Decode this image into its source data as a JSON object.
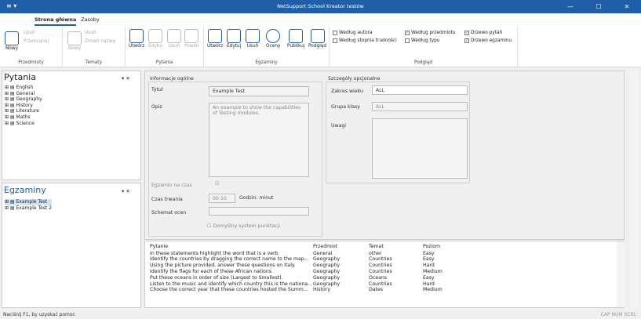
{
  "window": {
    "title": "NetSupport School Kreator testów",
    "qa_icon": "≡ ▾",
    "min": "—",
    "max": "☐",
    "close": "✕"
  },
  "tabs": [
    {
      "label": "Strona główna"
    },
    {
      "label": "Zasoby"
    }
  ],
  "ribbon": {
    "przedmioty": {
      "label": "Przedmioty",
      "nowy": "Nowy",
      "usun": "Usuń",
      "przemianuj": "Przemianuj"
    },
    "tematy": {
      "label": "Tematy",
      "nowy": "Nowy",
      "usun": "Usuń",
      "zmien": "Zmień nazwę"
    },
    "pytania": {
      "label": "Pytania",
      "utworz": "Utwórz",
      "edytuj": "Edytuj",
      "usun": "Usuń",
      "powiel": "Powiel"
    },
    "egzaminy": {
      "label": "Egzaminy",
      "utworz": "Utwórz",
      "edytuj": "Edytuj",
      "usun": "Usuń",
      "oceny": "Oceny",
      "publikuj": "Publikuj",
      "podglad": "Podgląd"
    },
    "podglad": {
      "label": "Podgląd",
      "autor": "Według autora",
      "stopien": "Według stopnia trudności",
      "przedmiot": "Według przedmiotu",
      "typ": "Według typu",
      "drzewo_pytan": "Drzewo pytań",
      "drzewo_egz": "Drzewo egzaminu"
    }
  },
  "pytania_panel": {
    "title": "Pytania",
    "close": "▾  ✕",
    "items": [
      "English",
      "General",
      "Geography",
      "History",
      "Literature",
      "Maths",
      "Science"
    ]
  },
  "egzaminy_panel": {
    "title": "Egzaminy",
    "close": "▾  ✕",
    "items": [
      "Example Test",
      "Example Test 2"
    ]
  },
  "form": {
    "general": "Informacje ogólne",
    "tytul_lbl": "Tytuł",
    "tytul": "Example Test",
    "opis_lbl": "Opis",
    "opis": "An example to show the capabilities of Testing modules.",
    "czas_lbl": "Egzamin na czas",
    "trwanie_lbl": "Czas trwania",
    "trwanie": "00:10",
    "godzin": "Godzin: minut",
    "schemat_lbl": "Schemat ocen",
    "domyslny": "Domyślny system punktacji",
    "opc": "Szczegóły opcjonalne",
    "zakres_lbl": "Zakres wieku",
    "zakres": "ALL",
    "grupa_lbl": "Grupa klasy",
    "grupa": "ALL",
    "uwagi_lbl": "Uwagi"
  },
  "grid": {
    "headers": [
      "Pytanie",
      "Przedmiot",
      "Temat",
      "Poziom"
    ],
    "rows": [
      [
        "In these statements highlight the word that is a verb",
        "General",
        "other",
        "Easy"
      ],
      [
        "Identify the countries by dragging the correct name to the map...",
        "Geography",
        "Countries",
        "Easy"
      ],
      [
        "Using the picture provided, answer these questions on Italy.",
        "Geography",
        "Countries",
        "Hard"
      ],
      [
        "Identify the flags for each of these African nations.",
        "Geography",
        "Countries",
        "Medium"
      ],
      [
        "Put these oceans in order of size (Largest to Smallest).",
        "Geography",
        "Oceans",
        "Easy"
      ],
      [
        "Listen to the music and identify which country this is the nationa...",
        "Geography",
        "Countries",
        "Hard"
      ],
      [
        "Choose the correct year that these countries hosted the Summ...",
        "History",
        "Dates",
        "Medium"
      ]
    ]
  },
  "status": {
    "help": "Naciśnij F1, by uzyskać pomoc",
    "keys": "CAP  NUM  SCRL"
  }
}
